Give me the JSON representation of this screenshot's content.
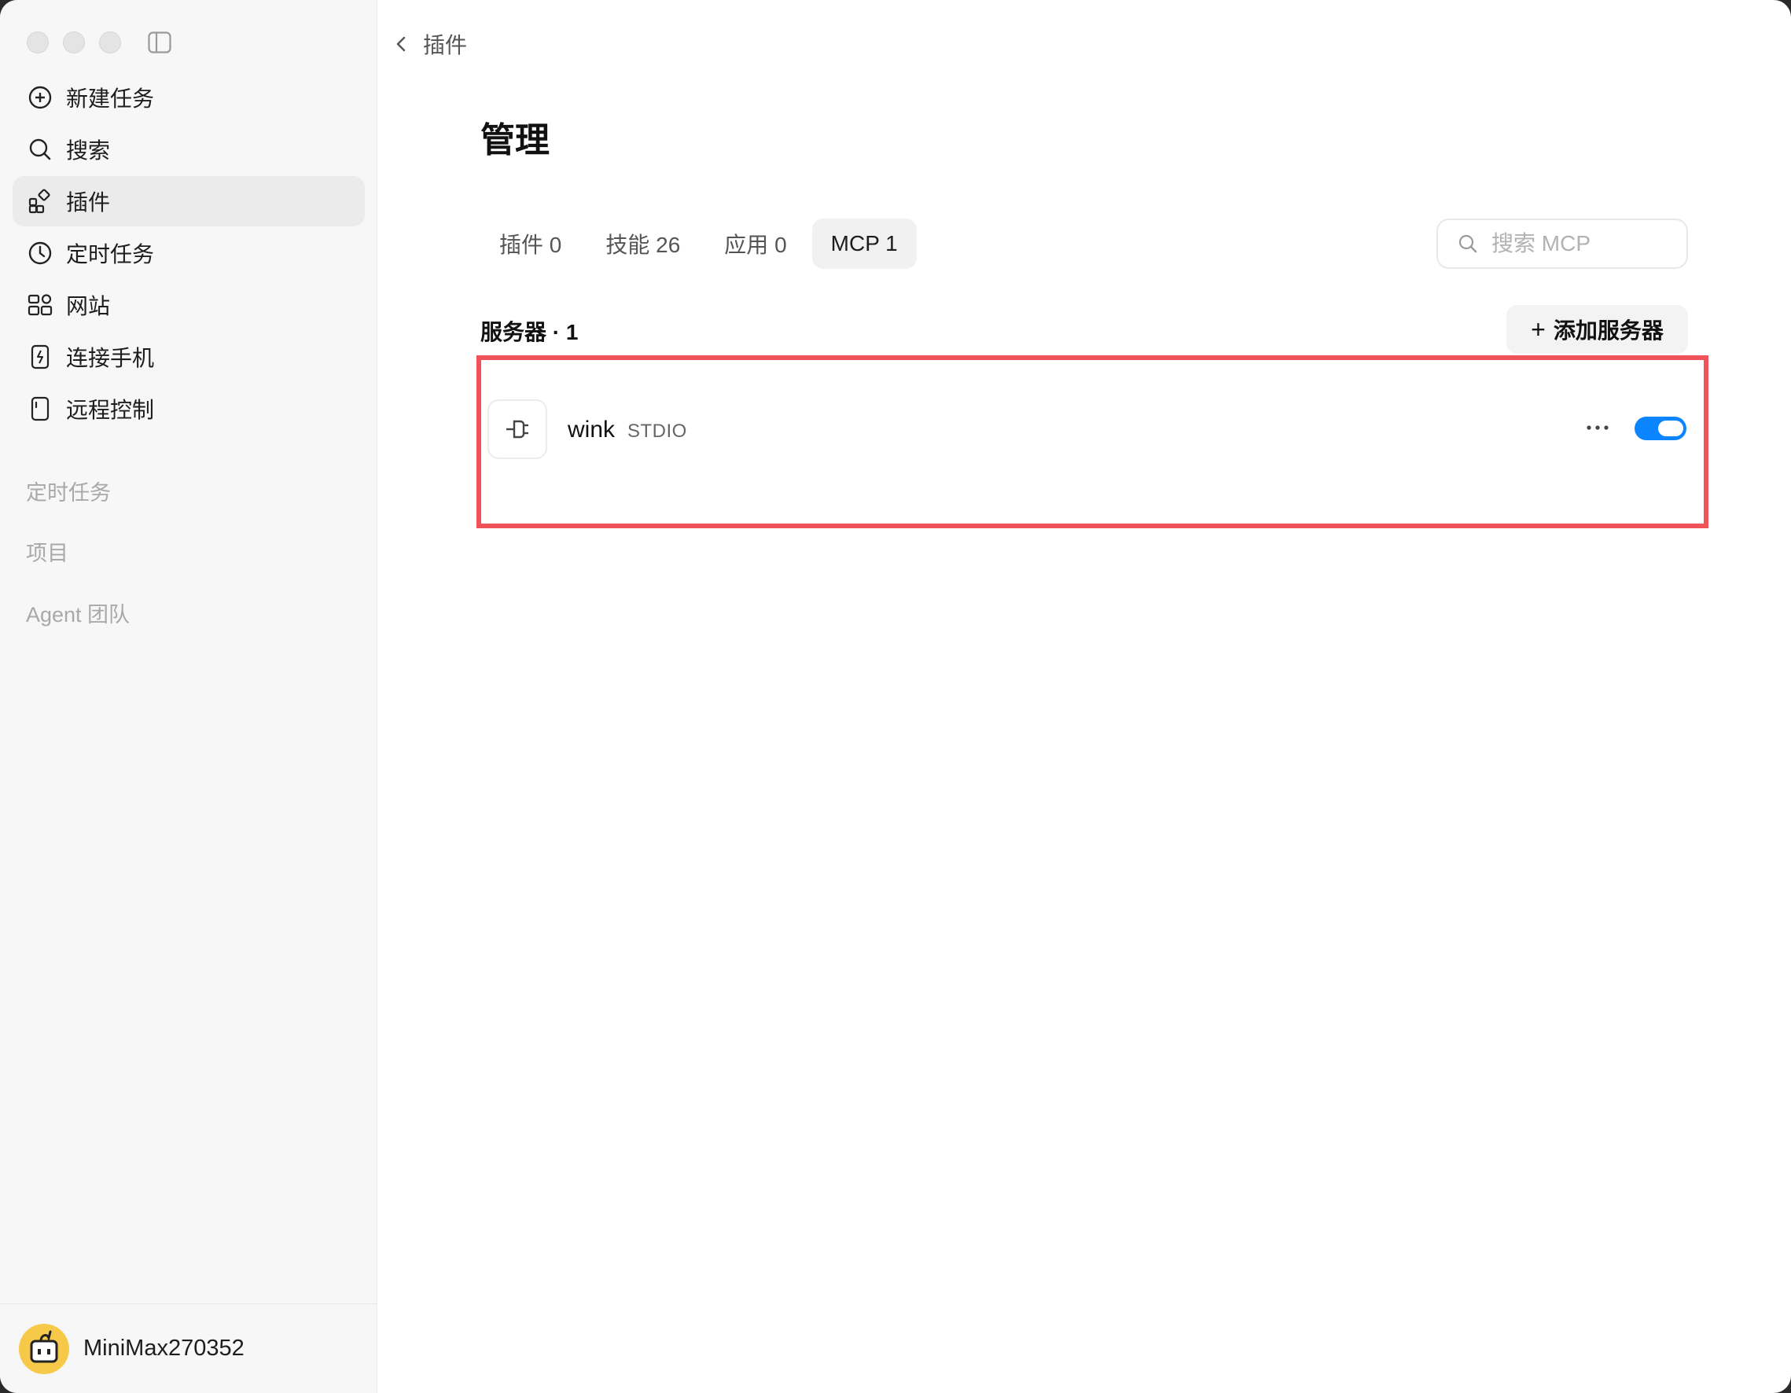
{
  "sidebar": {
    "items": [
      {
        "label": "新建任务",
        "icon": "plus-circle-icon"
      },
      {
        "label": "搜索",
        "icon": "search-icon"
      },
      {
        "label": "插件",
        "icon": "plugin-icon"
      },
      {
        "label": "定时任务",
        "icon": "clock-icon"
      },
      {
        "label": "网站",
        "icon": "website-icon"
      },
      {
        "label": "连接手机",
        "icon": "phone-icon"
      },
      {
        "label": "远程控制",
        "icon": "remote-icon"
      }
    ],
    "sections": [
      "定时任务",
      "项目",
      "Agent 团队"
    ],
    "user": {
      "name": "MiniMax270352"
    }
  },
  "header": {
    "back_label": "插件"
  },
  "main": {
    "title": "管理",
    "tabs": [
      {
        "label": "插件 0"
      },
      {
        "label": "技能 26"
      },
      {
        "label": "应用 0"
      },
      {
        "label": "MCP 1"
      }
    ],
    "active_tab": "MCP 1",
    "search": {
      "placeholder": "搜索 MCP",
      "value": ""
    },
    "servers_label": "服务器 · 1",
    "add_button": "添加服务器",
    "servers": [
      {
        "name": "wink",
        "type": "STDIO",
        "enabled": true
      }
    ]
  },
  "colors": {
    "accent": "#0a84ff",
    "highlight_border": "#f0525a"
  }
}
